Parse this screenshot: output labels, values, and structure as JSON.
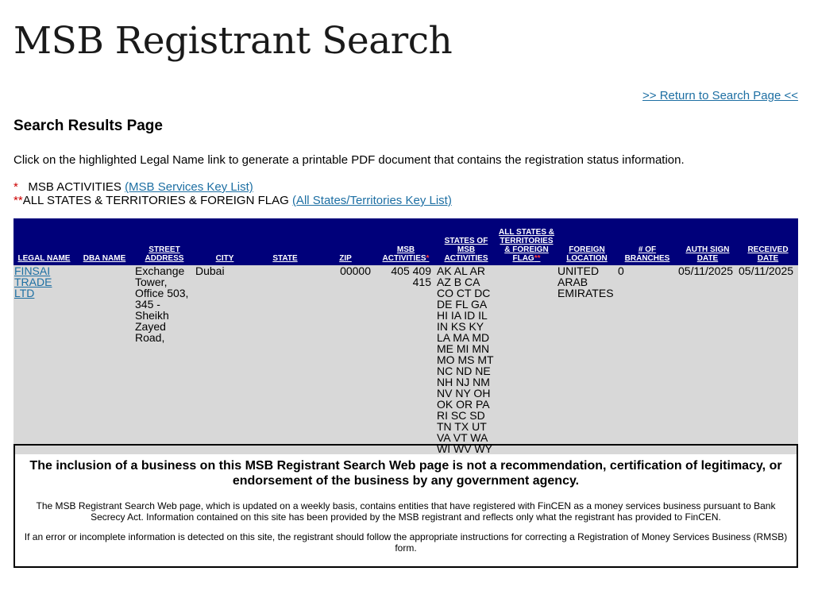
{
  "header": {
    "title": "MSB Registrant Search",
    "return_link": ">> Return to Search Page <<"
  },
  "subtitle": "Search Results Page",
  "instructions": "Click on the highlighted Legal Name link to generate a printable PDF document that contains the registration status information.",
  "keys": {
    "msb_marker": "*",
    "msb_label": "MSB ACTIVITIES",
    "msb_link": "(MSB Services Key List)",
    "states_marker": "**",
    "states_label": "ALL STATES & TERRITORIES & FOREIGN FLAG",
    "states_link": "(All States/Territories Key List)"
  },
  "table": {
    "columns": {
      "legal_name": "LEGAL NAME",
      "dba_name": "DBA NAME",
      "street_address": "STREET ADDRESS",
      "city": "CITY",
      "state": "STATE",
      "zip": "ZIP",
      "msb_activities": "MSB ACTIVITIES",
      "msb_activities_star": "*",
      "states_of_msb_activities": "STATES OF MSB ACTIVITIES",
      "all_states_flag": "ALL STATES & TERRITORIES & FOREIGN FLAG",
      "all_states_flag_star": "**",
      "foreign_location": "FOREIGN LOCATION",
      "branches": "# OF BRANCHES",
      "auth_sign_date": "AUTH SIGN DATE",
      "received_date": "RECEIVED DATE"
    },
    "rows": [
      {
        "legal_name": "FINSAI TRADE LTD",
        "dba_name": "",
        "street_address": "Exchange Tower, Office 503, 345 - Sheikh Zayed Road,",
        "city": "Dubai",
        "state": "",
        "zip": "00000",
        "msb_activities": "405 409 415",
        "states_of_msb_activities": "AK AL AR AZ B CA CO CT DC DE FL GA HI IA ID IL IN KS KY LA MA MD ME MI MN MO MS MT NC ND NE NH NJ NM NV NY OH OK OR PA RI SC SD TN TX UT VA VT WA WI WV WY",
        "all_states_flag": "",
        "foreign_location": "UNITED ARAB EMIRATES",
        "branches": "0",
        "auth_sign_date": "05/11/2025",
        "received_date": "05/11/2025"
      }
    ]
  },
  "disclaimer": {
    "bold": "The inclusion of a business on this MSB Registrant Search Web page is not a recommendation, certification of legitimacy, or endorsement of the business by any government agency.",
    "p1": "The MSB Registrant Search Web page, which is updated on a weekly basis, contains entities that have registered with FinCEN as a money services business pursuant to Bank Secrecy Act. Information contained on this site has been provided by the MSB registrant and reflects only what the registrant has provided to FinCEN.",
    "p2": "If an error or incomplete information is detected on this site, the registrant should follow the appropriate instructions for correcting a Registration of Money Services Business (RMSB) form."
  }
}
